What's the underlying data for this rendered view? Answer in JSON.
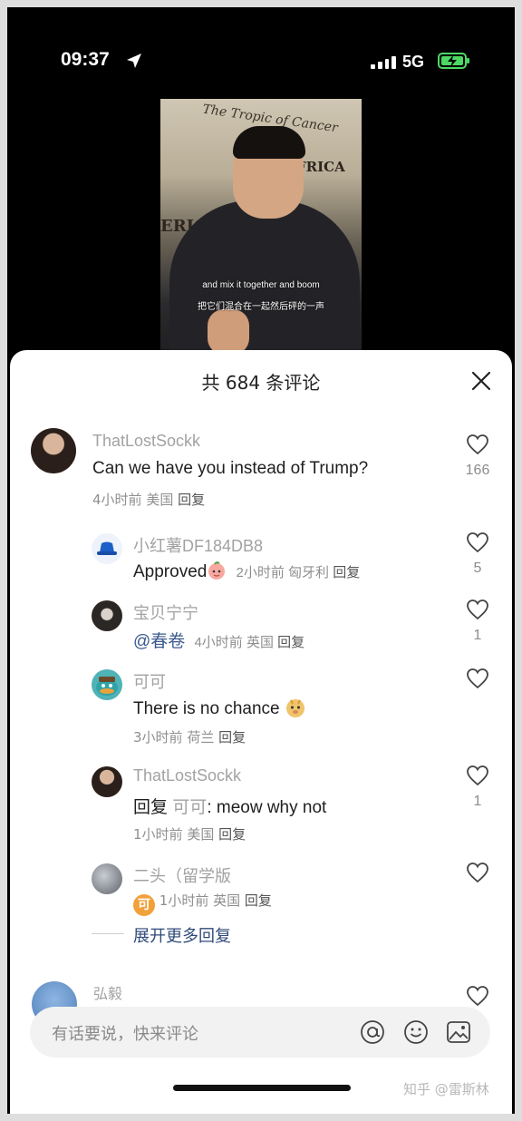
{
  "status_bar": {
    "time": "09:37",
    "network": "5G"
  },
  "video": {
    "map_labels": [
      "The Tropic of Cancer",
      "FRICA",
      "ERIC"
    ],
    "subtitle_en": "and mix it together and boom",
    "subtitle_cn": "把它们混合在一起然后砰的一声"
  },
  "sheet": {
    "title": "共 684 条评论"
  },
  "comments": [
    {
      "user": "ThatLostSockk",
      "text": "Can we have you instead of Trump?",
      "time": "4小时前",
      "region": "美国",
      "reply": "回复",
      "likes": "166"
    },
    {
      "user": "小红薯DF184DB8",
      "text": "Approved",
      "emoji": "peach-face",
      "time": "2小时前",
      "region": "匈牙利",
      "reply": "回复",
      "likes": "5"
    },
    {
      "user": "宝贝宁宁",
      "text": "@春卷",
      "time": "4小时前",
      "region": "英国",
      "reply": "回复",
      "likes": "1"
    },
    {
      "user": "可可",
      "text": "There is no chance",
      "emoji": "doge",
      "time": "3小时前",
      "region": "荷兰",
      "reply": "回复",
      "likes": ""
    },
    {
      "user": "ThatLostSockk",
      "text_prefix": "回复",
      "text_target": "可可",
      "text": ": meow why not",
      "time": "1小时前",
      "region": "美国",
      "reply": "回复",
      "likes": "1"
    },
    {
      "user": "二头（留学版",
      "badge": "可",
      "time": "1小时前",
      "region": "英国",
      "reply": "回复",
      "likes": ""
    }
  ],
  "expand_label": "展开更多回复",
  "next_comment_user": "弘毅",
  "input": {
    "placeholder": "有话要说，快来评论"
  },
  "watermark": "知乎 @雷斯林",
  "colors": {
    "accent_blue": "#304a7a",
    "text_gray": "#a2a2a2",
    "badge_orange": "#f2a13a"
  }
}
